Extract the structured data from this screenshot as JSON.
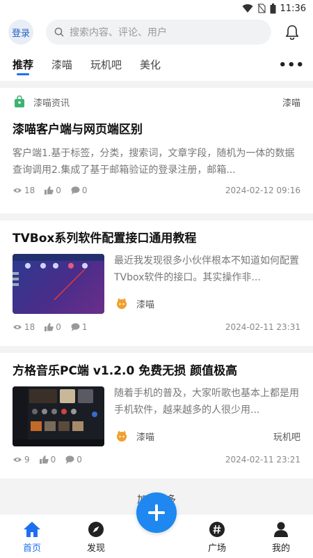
{
  "status_bar": {
    "time": "11:36"
  },
  "header": {
    "login_label": "登录",
    "search_placeholder": "搜索内容、评论、用户"
  },
  "tabs": [
    {
      "label": "推荐",
      "active": true
    },
    {
      "label": "漆喵"
    },
    {
      "label": "玩机吧"
    },
    {
      "label": "美化"
    }
  ],
  "posts": [
    {
      "source": "漆喵资讯",
      "source_tag": "漆喵",
      "title": "漆喵客户端与网页端区别",
      "excerpt": "客户端1.基于标签，分类，搜索词，文章字段，随机为一体的数据查询调用2.集成了基于邮箱验证的登录注册，邮箱...",
      "views": "18",
      "likes": "0",
      "comments": "0",
      "date": "2024-02-12 09:16"
    },
    {
      "title": "TVBox系列软件配置接口通用教程",
      "excerpt": "最近我发现很多小伙伴根本不知道如何配置TVbox软件的接口。其实操作非...",
      "author": "漆喵",
      "tag": "",
      "views": "18",
      "likes": "0",
      "comments": "1",
      "date": "2024-02-11 23:31"
    },
    {
      "title": "方格音乐PC端 v1.2.0 免费无损 颜值极高",
      "excerpt": "随着手机的普及，大家听歌也基本上都是用手机软件，越来越多的人很少用...",
      "author": "漆喵",
      "tag": "玩机吧",
      "views": "9",
      "likes": "0",
      "comments": "0",
      "date": "2024-02-11 23:21"
    }
  ],
  "load_more": "加载更多",
  "bottom_nav": [
    {
      "label": "首页",
      "icon": "home-icon",
      "active": true
    },
    {
      "label": "发现",
      "icon": "compass-icon"
    },
    {
      "label": "广场",
      "icon": "hashtag-icon"
    },
    {
      "label": "我的",
      "icon": "user-icon"
    }
  ],
  "colors": {
    "accent": "#1e6ff0",
    "fab": "#1e88f0"
  }
}
